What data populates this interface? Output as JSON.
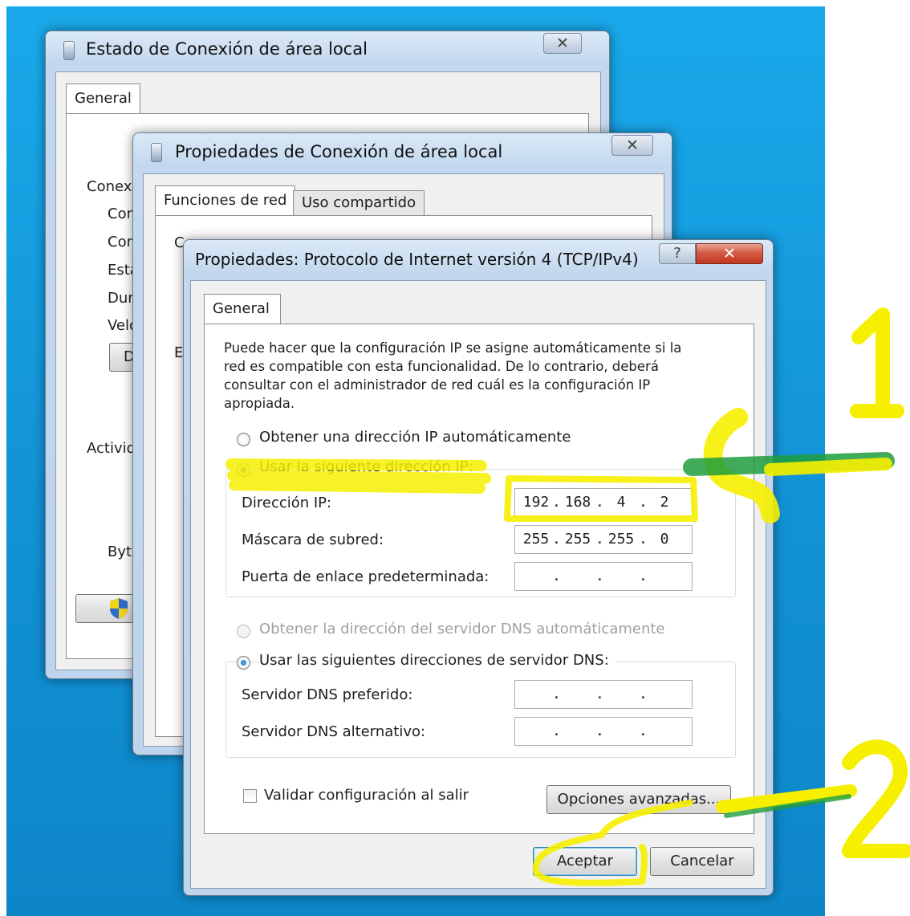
{
  "win_back": {
    "title": "Estado de Conexión de área local",
    "close_label": "✕",
    "tab_general": "General",
    "labels_partial": [
      "Conexi",
      "Con",
      "Con",
      "Esta",
      "Dur",
      "Velo",
      "D",
      "Activid",
      "Byt"
    ]
  },
  "win_mid": {
    "title": "Propiedades de Conexión de área local",
    "close_label": "✕",
    "tabs": [
      "Funciones de red",
      "Uso compartido"
    ],
    "partial_labels": [
      "C",
      "E"
    ]
  },
  "win_front": {
    "title": "Propiedades: Protocolo de Internet versión 4 (TCP/IPv4)",
    "help_label": "?",
    "close_label": "✕",
    "tab_general": "General",
    "description": [
      "Puede hacer que la configuración IP se asigne automáticamente si la",
      "red es compatible con esta funcionalidad. De lo contrario, deberá",
      "consultar con el administrador de red cuál es la configuración IP",
      "apropiada."
    ],
    "ip_auto_label": "Obtener una dirección IP automáticamente",
    "ip_manual_label": "Usar la siguiente dirección IP:",
    "ip_address_label": "Dirección IP:",
    "ip_address": [
      "192",
      "168",
      "4",
      "2"
    ],
    "subnet_label": "Máscara de subred:",
    "subnet": [
      "255",
      "255",
      "255",
      "0"
    ],
    "gateway_label": "Puerta de enlace predeterminada:",
    "gateway": [
      "",
      "",
      "",
      ""
    ],
    "dns_auto_label": "Obtener la dirección del servidor DNS automáticamente",
    "dns_manual_label": "Usar las siguientes direcciones de servidor DNS:",
    "dns_pref_label": "Servidor DNS preferido:",
    "dns_pref": [
      "",
      "",
      "",
      ""
    ],
    "dns_alt_label": "Servidor DNS alternativo:",
    "dns_alt": [
      "",
      "",
      "",
      ""
    ],
    "validate_label": "Validar configuración al salir",
    "advanced_label": "Opciones avanzadas...",
    "ok_label": "Aceptar",
    "cancel_label": "Cancelar"
  },
  "annotations": {
    "marker_1": "1",
    "marker_2": "2"
  },
  "colors": {
    "highlight": "#f6f000",
    "green_stroke": "#1f9d3c",
    "desktop": "#1aa3e4"
  }
}
